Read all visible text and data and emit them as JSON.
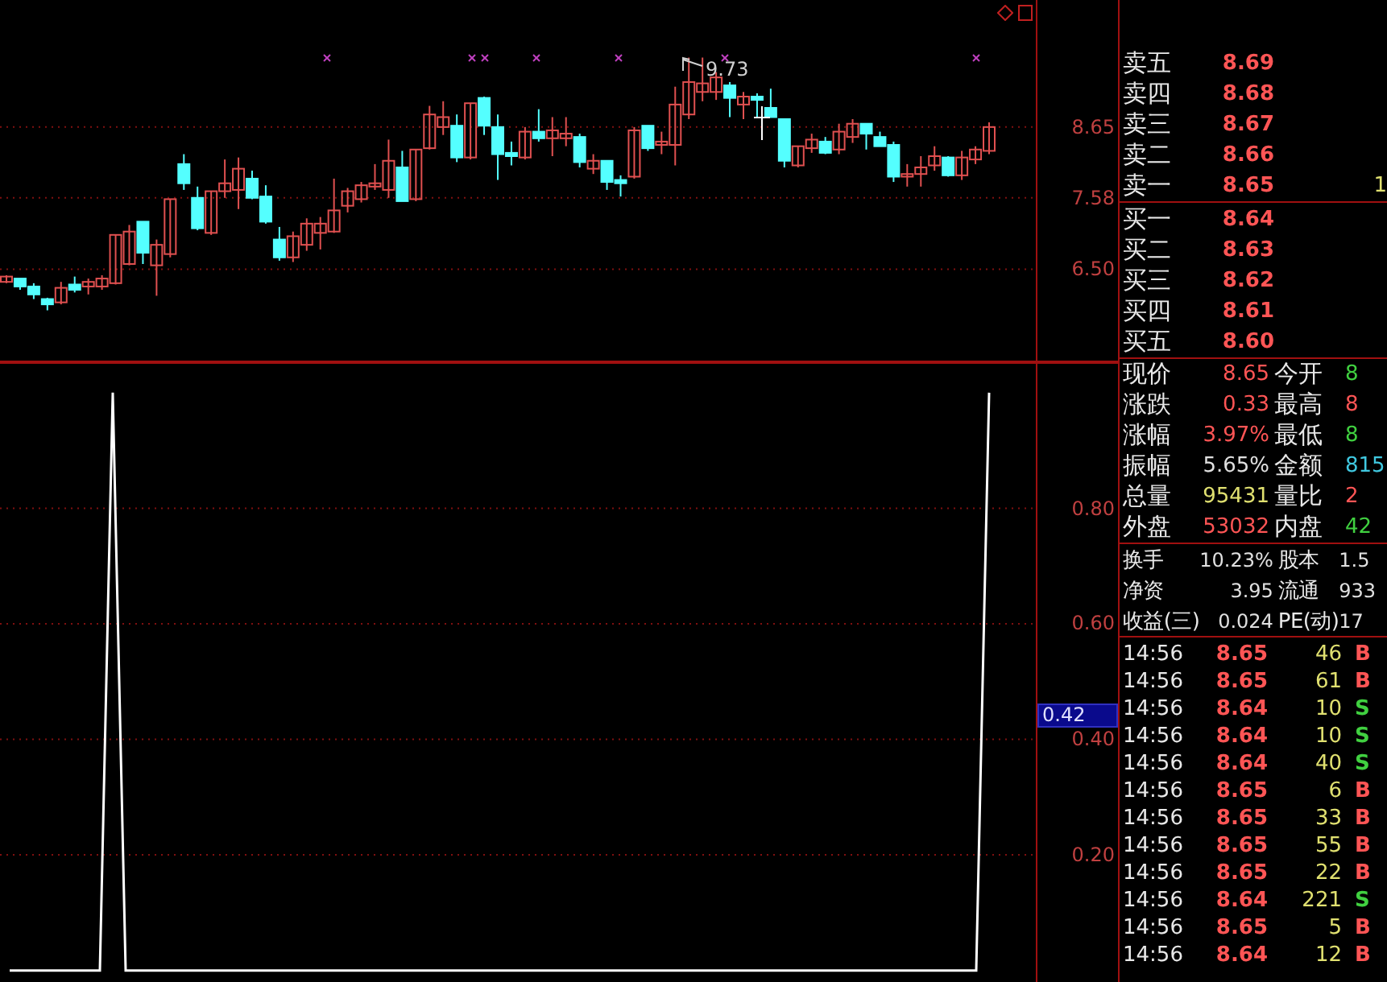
{
  "price_chart": {
    "peak_label": "9.73",
    "chart_data": {
      "type": "candlestick",
      "ohlc": [
        [
          6.31,
          6.41,
          6.29,
          6.39
        ],
        [
          6.36,
          6.36,
          6.19,
          6.24
        ],
        [
          6.24,
          6.29,
          6.05,
          6.12
        ],
        [
          6.05,
          6.07,
          5.88,
          5.97
        ],
        [
          6.0,
          6.31,
          5.97,
          6.22
        ],
        [
          6.27,
          6.39,
          6.15,
          6.19
        ],
        [
          6.24,
          6.36,
          6.12,
          6.31
        ],
        [
          6.24,
          6.41,
          6.19,
          6.36
        ],
        [
          6.29,
          7.02,
          6.27,
          7.02
        ],
        [
          6.58,
          7.17,
          6.56,
          7.07
        ],
        [
          7.22,
          7.22,
          6.58,
          6.75
        ],
        [
          6.56,
          6.95,
          6.1,
          6.87
        ],
        [
          6.73,
          7.56,
          6.68,
          7.56
        ],
        [
          8.09,
          8.24,
          7.7,
          7.8
        ],
        [
          7.58,
          7.75,
          7.09,
          7.12
        ],
        [
          7.05,
          7.68,
          7.02,
          7.68
        ],
        [
          7.68,
          8.16,
          7.58,
          7.8
        ],
        [
          7.7,
          8.19,
          7.41,
          8.02
        ],
        [
          7.87,
          7.99,
          7.56,
          7.58
        ],
        [
          7.6,
          7.77,
          7.19,
          7.22
        ],
        [
          6.95,
          7.14,
          6.63,
          6.68
        ],
        [
          6.68,
          7.07,
          6.61,
          7.0
        ],
        [
          6.87,
          7.27,
          6.78,
          7.19
        ],
        [
          7.05,
          7.29,
          6.8,
          7.19
        ],
        [
          7.07,
          7.87,
          7.05,
          7.39
        ],
        [
          7.46,
          7.73,
          7.36,
          7.68
        ],
        [
          7.56,
          7.82,
          7.51,
          7.77
        ],
        [
          7.75,
          8.09,
          7.7,
          7.8
        ],
        [
          7.7,
          8.46,
          7.58,
          8.14
        ],
        [
          8.04,
          8.29,
          7.53,
          7.53
        ],
        [
          7.56,
          8.31,
          7.53,
          8.31
        ],
        [
          8.33,
          8.97,
          8.31,
          8.84
        ],
        [
          8.65,
          9.04,
          8.53,
          8.8
        ],
        [
          8.67,
          8.84,
          8.12,
          8.19
        ],
        [
          8.19,
          9.01,
          8.16,
          9.01
        ],
        [
          9.09,
          9.11,
          8.53,
          8.67
        ],
        [
          8.65,
          8.84,
          7.85,
          8.24
        ],
        [
          8.26,
          8.43,
          8.07,
          8.21
        ],
        [
          8.19,
          8.65,
          8.16,
          8.58
        ],
        [
          8.58,
          8.92,
          8.43,
          8.48
        ],
        [
          8.48,
          8.8,
          8.21,
          8.6
        ],
        [
          8.48,
          8.8,
          8.36,
          8.55
        ],
        [
          8.5,
          8.55,
          8.04,
          8.12
        ],
        [
          8.02,
          8.24,
          7.94,
          8.14
        ],
        [
          8.14,
          8.14,
          7.7,
          7.82
        ],
        [
          7.85,
          7.92,
          7.6,
          7.8
        ],
        [
          7.9,
          8.65,
          7.87,
          8.6
        ],
        [
          8.67,
          8.67,
          8.29,
          8.33
        ],
        [
          8.38,
          8.58,
          8.24,
          8.43
        ],
        [
          8.38,
          9.26,
          8.07,
          8.99
        ],
        [
          8.84,
          9.7,
          8.77,
          9.33
        ],
        [
          9.18,
          9.7,
          9.04,
          9.31
        ],
        [
          9.18,
          9.48,
          9.06,
          9.4
        ],
        [
          9.28,
          9.33,
          8.8,
          9.09
        ],
        [
          8.99,
          9.18,
          8.77,
          9.11
        ],
        [
          9.11,
          9.16,
          8.8,
          9.06
        ],
        [
          8.94,
          9.23,
          8.8,
          8.8
        ],
        [
          8.77,
          8.77,
          8.04,
          8.14
        ],
        [
          8.07,
          8.36,
          8.04,
          8.36
        ],
        [
          8.33,
          8.55,
          8.26,
          8.46
        ],
        [
          8.43,
          8.5,
          8.24,
          8.26
        ],
        [
          8.31,
          8.7,
          8.24,
          8.58
        ],
        [
          8.5,
          8.77,
          8.41,
          8.7
        ],
        [
          8.7,
          8.7,
          8.31,
          8.55
        ],
        [
          8.5,
          8.58,
          8.36,
          8.36
        ],
        [
          8.38,
          8.43,
          7.82,
          7.9
        ],
        [
          7.9,
          8.09,
          7.75,
          7.94
        ],
        [
          7.94,
          8.21,
          7.75,
          8.04
        ],
        [
          8.07,
          8.36,
          7.99,
          8.21
        ],
        [
          8.19,
          8.21,
          7.9,
          7.92
        ],
        [
          7.92,
          8.29,
          7.85,
          8.19
        ],
        [
          8.16,
          8.36,
          8.09,
          8.31
        ],
        [
          8.29,
          8.72,
          8.24,
          8.65
        ]
      ],
      "ylim": [
        5.12,
        10.57
      ],
      "grid": true,
      "yticks": [
        {
          "value": 8.65,
          "label": "8.65"
        },
        {
          "value": 7.58,
          "label": "7.58"
        },
        {
          "value": 6.5,
          "label": "6.50"
        }
      ]
    }
  },
  "indicator_chart": {
    "cursor_value": "0.42",
    "chart_data": {
      "type": "line",
      "series": [
        {
          "color": "#ffffff",
          "values": [
            0,
            0,
            0,
            0,
            0,
            0,
            0,
            0,
            1,
            0,
            0,
            0,
            0,
            0,
            0,
            0,
            0,
            0,
            0,
            0,
            0,
            0,
            0,
            0,
            0,
            0,
            0,
            0,
            0,
            0,
            0,
            0,
            0,
            0,
            0,
            0,
            0,
            0,
            0,
            0,
            0,
            0,
            0,
            0,
            0,
            0,
            0,
            0,
            0,
            0,
            0,
            0,
            0,
            0,
            0,
            0,
            0,
            0,
            0,
            0,
            0,
            0,
            0,
            0,
            0,
            0,
            0,
            0,
            0,
            0,
            0,
            0,
            0,
            0,
            0,
            0,
            1
          ]
        }
      ],
      "ylim": [
        -0.02,
        1.05
      ],
      "grid": true,
      "yticks": [
        {
          "value": 0.2,
          "label": "0.20"
        },
        {
          "value": 0.4,
          "label": "0.40"
        },
        {
          "value": 0.6,
          "label": "0.60"
        },
        {
          "value": 0.8,
          "label": "0.80"
        }
      ]
    }
  },
  "order_book": {
    "asks": [
      {
        "label": "卖五",
        "price": "8.69"
      },
      {
        "label": "卖四",
        "price": "8.68"
      },
      {
        "label": "卖三",
        "price": "8.67"
      },
      {
        "label": "卖二",
        "price": "8.66"
      },
      {
        "label": "卖一",
        "price": "8.65",
        "volume": "1"
      }
    ],
    "bids": [
      {
        "label": "买一",
        "price": "8.64"
      },
      {
        "label": "买二",
        "price": "8.63"
      },
      {
        "label": "买三",
        "price": "8.62"
      },
      {
        "label": "买四",
        "price": "8.61"
      },
      {
        "label": "买五",
        "price": "8.60"
      }
    ]
  },
  "quote_stats": [
    {
      "label": "现价",
      "value": "8.65",
      "color": "#ff5555"
    },
    {
      "label": "今开",
      "value": "8",
      "color": "#40d040"
    },
    {
      "label": "涨跌",
      "value": "0.33",
      "color": "#ff5555"
    },
    {
      "label": "最高",
      "value": "8",
      "color": "#ff5555"
    },
    {
      "label": "涨幅",
      "value": "3.97%",
      "color": "#ff5555"
    },
    {
      "label": "最低",
      "value": "8",
      "color": "#40d040"
    },
    {
      "label": "振幅",
      "value": "5.65%",
      "color": "#e0e0e0"
    },
    {
      "label": "金额",
      "value": "815",
      "color": "#40c8e0"
    },
    {
      "label": "总量",
      "value": "95431",
      "color": "#e0e070"
    },
    {
      "label": "量比",
      "value": "2",
      "color": "#ff5555"
    },
    {
      "label": "外盘",
      "value": "53032",
      "color": "#ff5555"
    },
    {
      "label": "内盘",
      "value": "42",
      "color": "#40d040"
    }
  ],
  "fundamentals": [
    {
      "label": "换手",
      "value": "10.23%"
    },
    {
      "label": "股本",
      "value": "1.5"
    },
    {
      "label": "净资",
      "value": "3.95"
    },
    {
      "label": "流通",
      "value": "933"
    },
    {
      "label": "收益(三)",
      "value": "0.024"
    },
    {
      "label": "PE(动)",
      "value": "17"
    }
  ],
  "trades": [
    {
      "time": "14:56",
      "price": "8.65",
      "volume": "46",
      "side": "B",
      "color": "#ff5555"
    },
    {
      "time": "14:56",
      "price": "8.65",
      "volume": "61",
      "side": "B",
      "color": "#ff5555"
    },
    {
      "time": "14:56",
      "price": "8.64",
      "volume": "10",
      "side": "S",
      "color": "#40d040"
    },
    {
      "time": "14:56",
      "price": "8.64",
      "volume": "10",
      "side": "S",
      "color": "#40d040"
    },
    {
      "time": "14:56",
      "price": "8.64",
      "volume": "40",
      "side": "S",
      "color": "#40d040"
    },
    {
      "time": "14:56",
      "price": "8.65",
      "volume": "6",
      "side": "B",
      "color": "#ff5555"
    },
    {
      "time": "14:56",
      "price": "8.65",
      "volume": "33",
      "side": "B",
      "color": "#ff5555"
    },
    {
      "time": "14:56",
      "price": "8.65",
      "volume": "55",
      "side": "B",
      "color": "#ff5555"
    },
    {
      "time": "14:56",
      "price": "8.65",
      "volume": "22",
      "side": "B",
      "color": "#ff5555"
    },
    {
      "time": "14:56",
      "price": "8.64",
      "volume": "221",
      "side": "S",
      "color": "#40d040"
    },
    {
      "time": "14:56",
      "price": "8.65",
      "volume": "5",
      "side": "B",
      "color": "#ff5555"
    },
    {
      "time": "14:56",
      "price": "8.64",
      "volume": "12",
      "side": "B",
      "color": "#ff5555"
    }
  ]
}
